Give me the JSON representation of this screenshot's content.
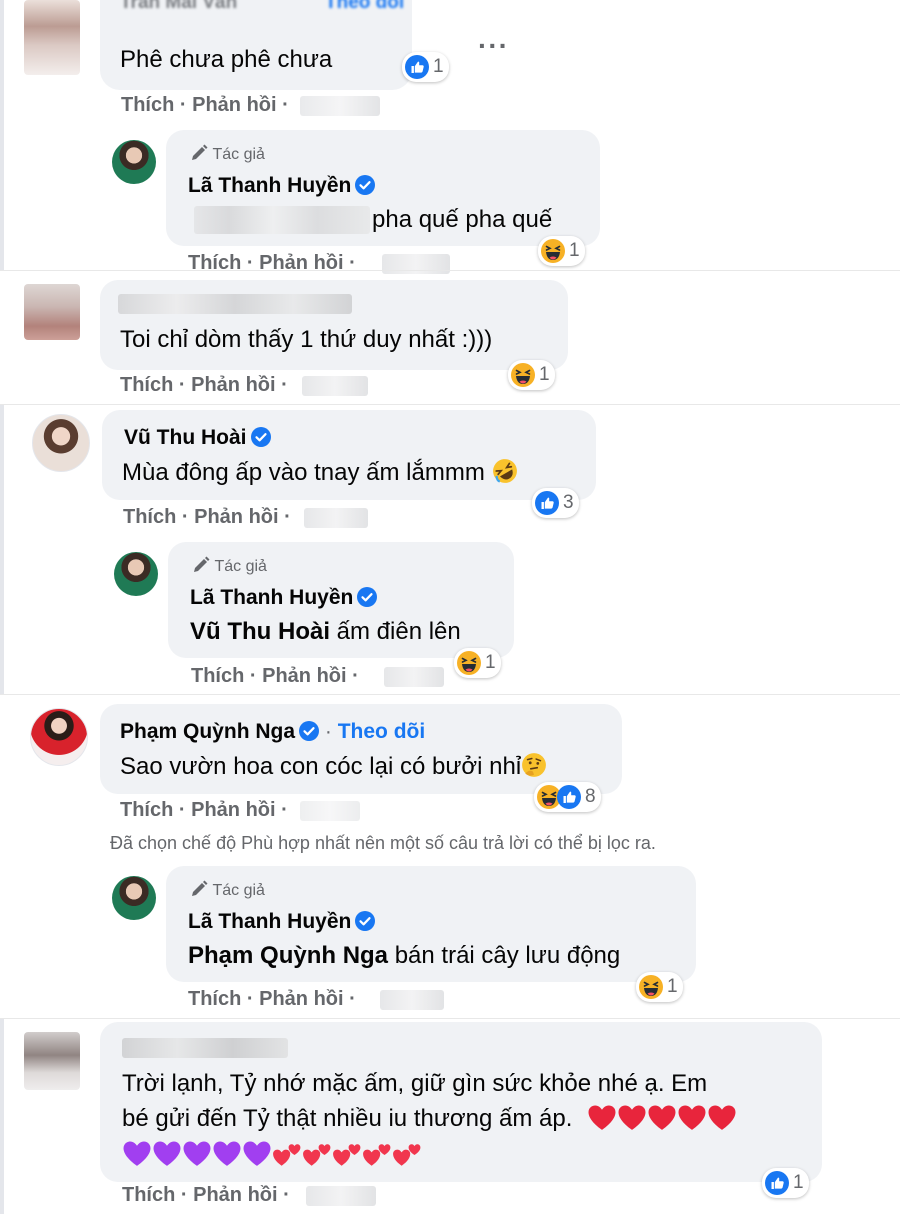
{
  "comments": [
    {
      "id": "c1",
      "name": "Trần Mai Vân",
      "follow": "Theo dõi",
      "text": "Phê chưa phê chưa",
      "reaction_count": "1",
      "like": "Thích",
      "reply": "Phản hồi",
      "more": "···"
    },
    {
      "id": "r1",
      "author_tag": "Tác giả",
      "name": "Lã Thanh Huyền",
      "text": "pha quế pha quế",
      "reaction_count": "1",
      "like": "Thích",
      "reply": "Phản hồi"
    },
    {
      "id": "c2",
      "text": "Toi chỉ dòm thấy 1 thứ duy nhất :)))",
      "reaction_count": "1",
      "like": "Thích",
      "reply": "Phản hồi"
    },
    {
      "id": "c3",
      "name": "Vũ Thu Hoài",
      "text": "Mùa đông ấp vào tnay ấm lắmmm",
      "reaction_count": "3",
      "like": "Thích",
      "reply": "Phản hồi"
    },
    {
      "id": "r2",
      "author_tag": "Tác giả",
      "name": "Lã Thanh Huyền",
      "mention": "Vũ Thu Hoài",
      "text": " ấm điên lên",
      "reaction_count": "1",
      "like": "Thích",
      "reply": "Phản hồi"
    },
    {
      "id": "c4",
      "name": "Phạm Quỳnh Nga",
      "follow": "Theo dõi",
      "text": "Sao vườn hoa con cóc lại có bưởi nhỉ",
      "reaction_count": "8",
      "like": "Thích",
      "reply": "Phản hồi"
    },
    {
      "id": "r3",
      "author_tag": "Tác giả",
      "name": "Lã Thanh Huyền",
      "mention": "Phạm Quỳnh Nga",
      "text": " bán trái cây lưu động",
      "reaction_count": "1",
      "like": "Thích",
      "reply": "Phản hồi"
    },
    {
      "id": "c5",
      "text_line1": "Trời lạnh, Tỷ nhớ mặc ấm, giữ gìn sức khỏe nhé ạ. Em",
      "text_line2": "bé gửi đến Tỷ thật nhiều iu thương ấm áp.",
      "reaction_count": "1",
      "like": "Thích",
      "reply": "Phản hồi"
    }
  ],
  "filter_notice": "Đã chọn chế độ Phù hợp nhất nên một số câu trả lời có thể bị lọc ra.",
  "colors": {
    "bubble": "#f0f2f5",
    "meta": "#65676b",
    "link": "#1877f2",
    "like_blue": "#1877f2",
    "haha_yellow": "#f7b125",
    "heart_red": "#f02849",
    "heart_purple": "#9b40ff"
  },
  "icons": [
    "like-icon",
    "haha-icon",
    "verified-icon",
    "pen-icon",
    "more-icon",
    "rolling-laugh-emoji",
    "thinking-emoji",
    "red-heart-emoji",
    "purple-heart-emoji",
    "two-hearts-emoji"
  ]
}
